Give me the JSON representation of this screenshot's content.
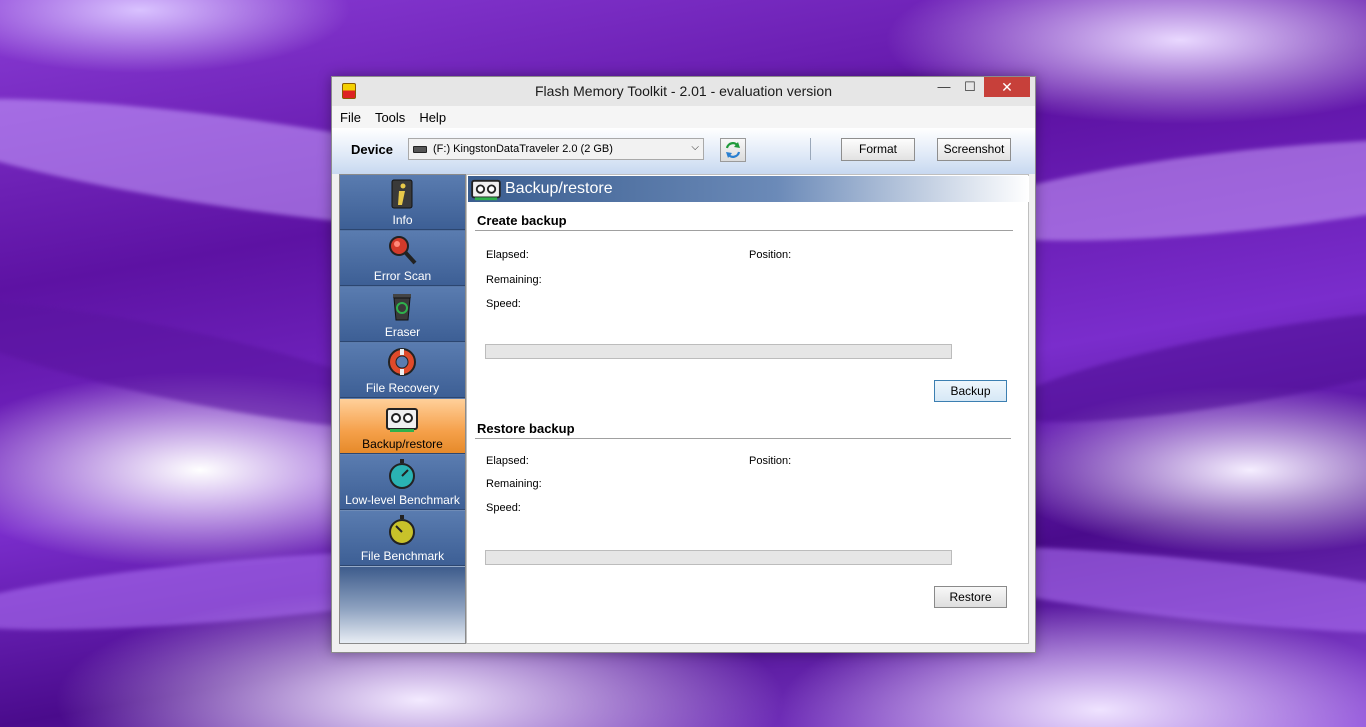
{
  "window": {
    "title": "Flash Memory Toolkit - 2.01 - evaluation version",
    "min_glyph": "—",
    "max_glyph": "☐",
    "close_glyph": "✕"
  },
  "menu": {
    "items": [
      "File",
      "Tools",
      "Help"
    ]
  },
  "toolbar": {
    "device_label": "Device",
    "device_value": "(F:) KingstonDataTraveler 2.0 (2 GB)",
    "format_label": "Format",
    "screenshot_label": "Screenshot"
  },
  "sidebar": {
    "items": [
      {
        "label": "Info",
        "icon": "info-icon"
      },
      {
        "label": "Error Scan",
        "icon": "magnifier-icon"
      },
      {
        "label": "Eraser",
        "icon": "recycle-bin-icon"
      },
      {
        "label": "File Recovery",
        "icon": "lifebuoy-icon"
      },
      {
        "label": "Backup/restore",
        "icon": "tape-drive-icon",
        "active": true
      },
      {
        "label": "Low-level Benchmark",
        "icon": "stopwatch-teal-icon"
      },
      {
        "label": "File Benchmark",
        "icon": "stopwatch-yellow-icon"
      }
    ]
  },
  "content": {
    "section_title": "Backup/restore",
    "create": {
      "title": "Create backup",
      "elapsed": "Elapsed:",
      "position": "Position:",
      "remaining": "Remaining:",
      "speed": "Speed:",
      "progress": 0,
      "button": "Backup"
    },
    "restore": {
      "title": "Restore backup",
      "elapsed": "Elapsed:",
      "position": "Position:",
      "remaining": "Remaining:",
      "speed": "Speed:",
      "progress": 0,
      "button": "Restore"
    }
  },
  "colors": {
    "accent_active": "#f5a04a",
    "sidebar": "#4d6ea0",
    "close_button": "#c7403a"
  }
}
